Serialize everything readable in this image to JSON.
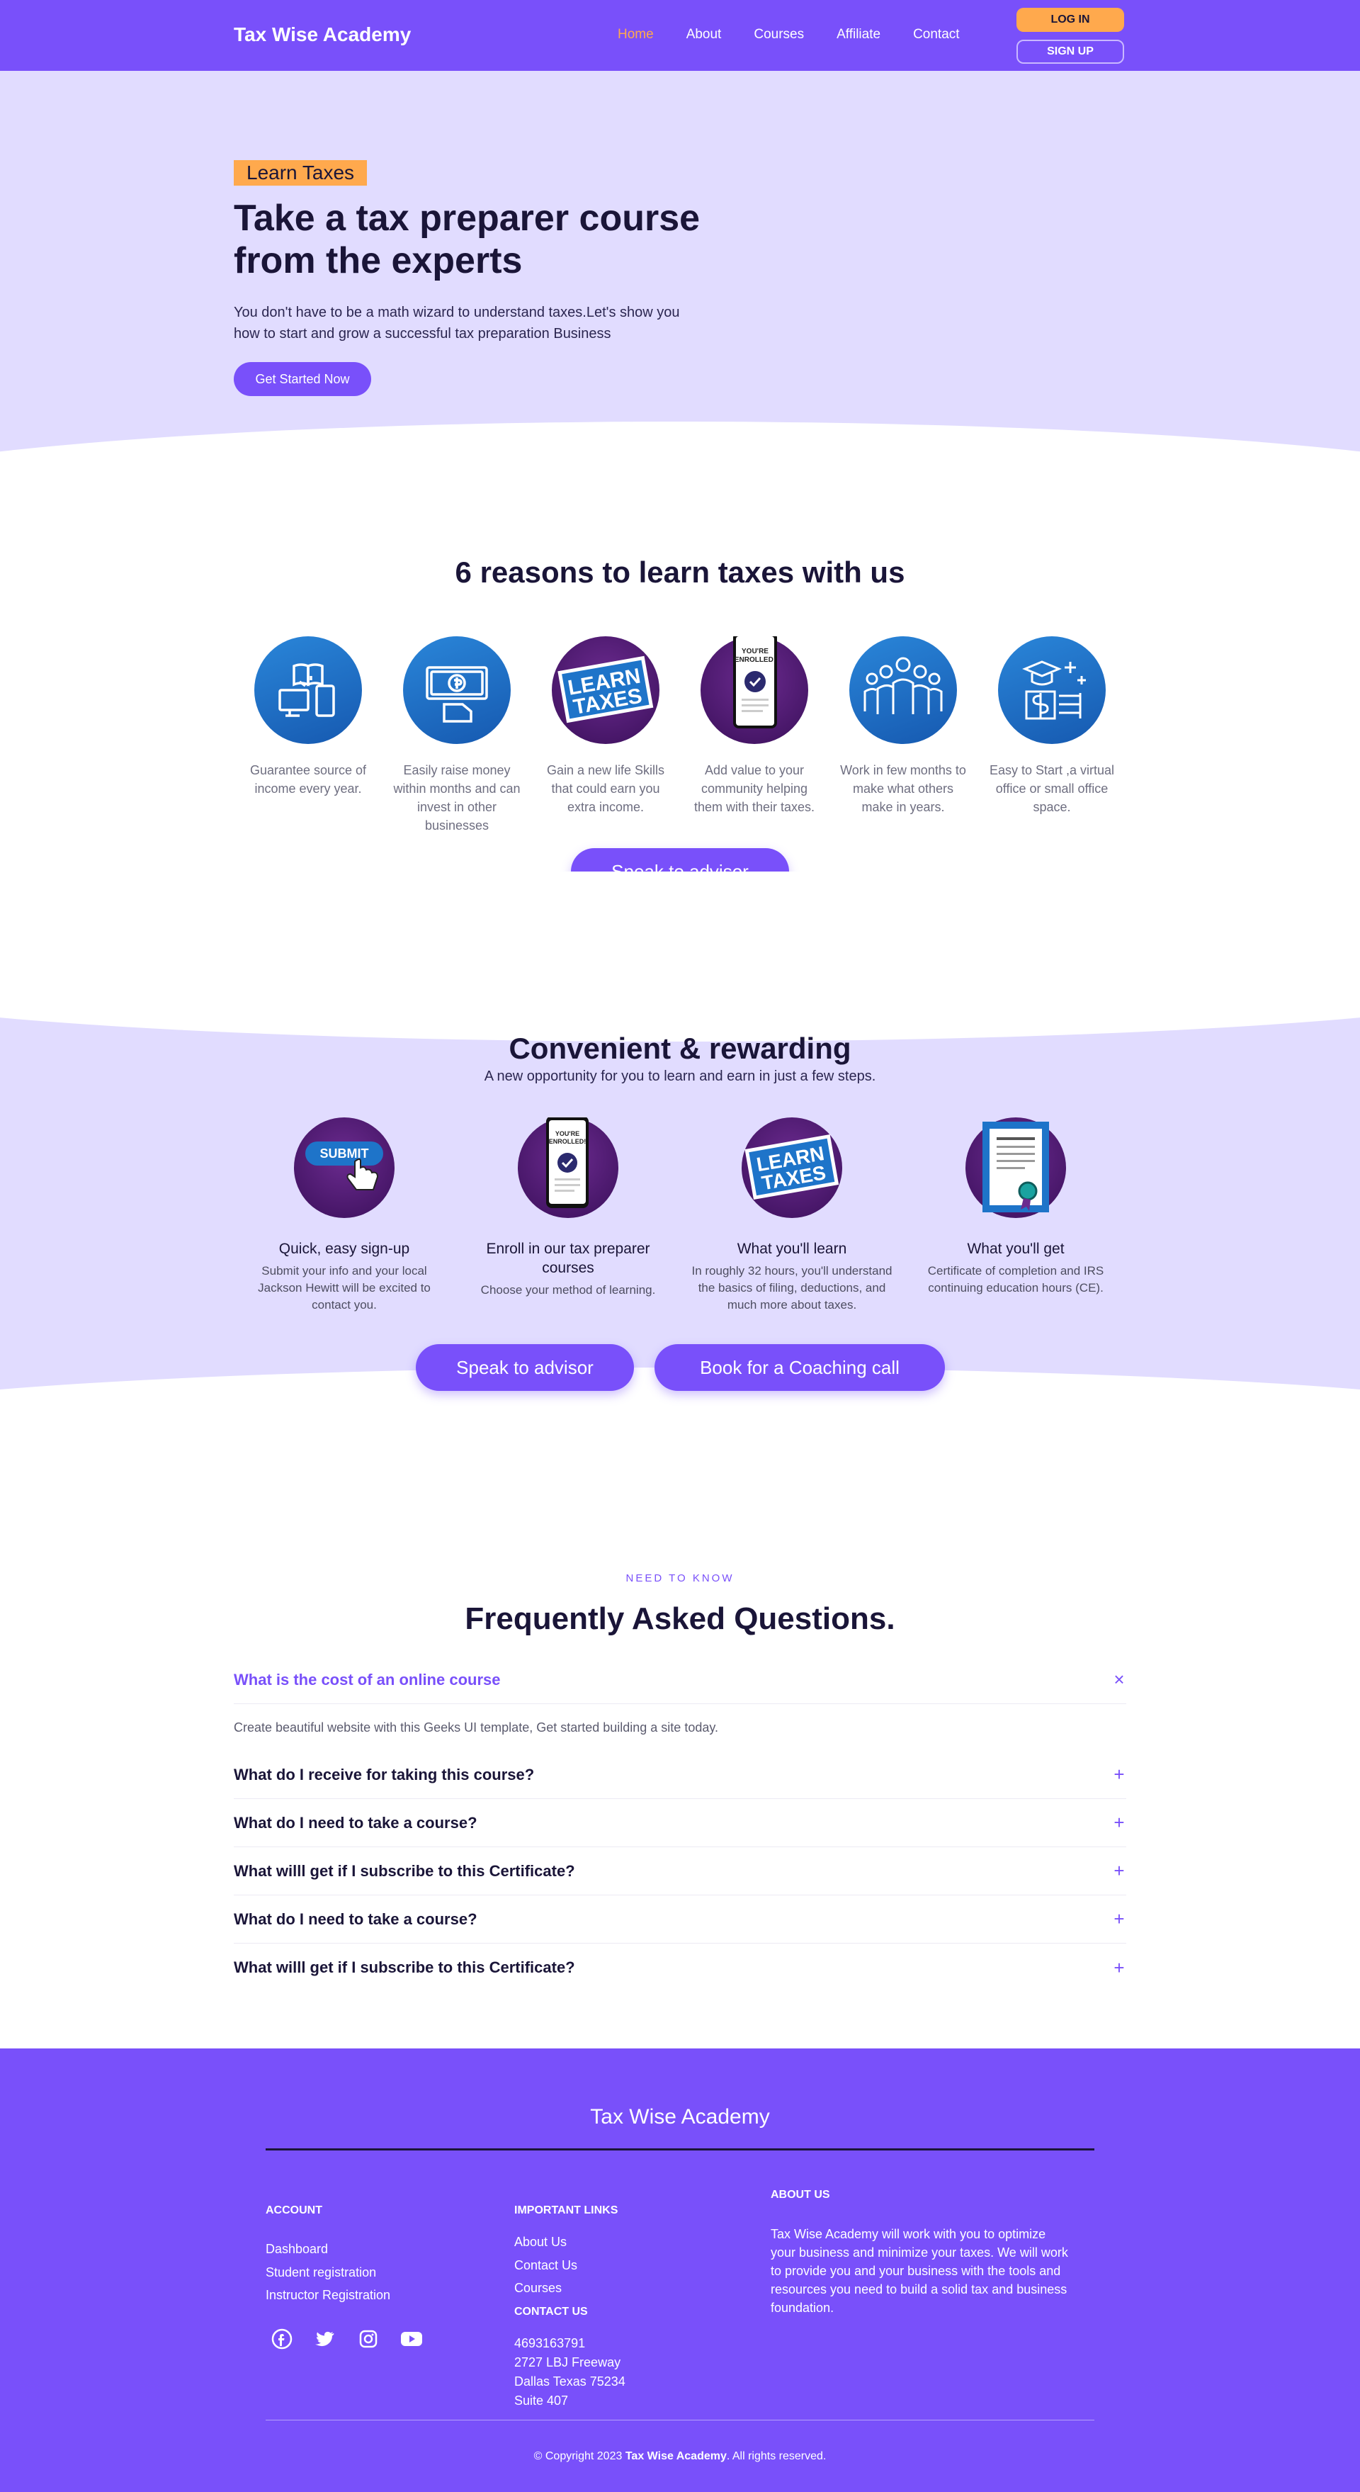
{
  "nav": {
    "brand": "Tax Wise Academy",
    "links": [
      "Home",
      "About",
      "Courses",
      "Affiliate",
      "Contact"
    ],
    "login": "LOG IN",
    "signup": "SIGN UP",
    "active_color": "#ffa94d"
  },
  "hero": {
    "tag": "Learn Taxes",
    "title": "Take a tax preparer course from the experts",
    "subtitle": "You don't have to be a math wizard to understand taxes.Let's show you how to start and grow a successful tax preparation Business",
    "cta": "Get Started Now"
  },
  "reasons": {
    "title": "6 reasons to learn taxes with us",
    "items": [
      {
        "text": "Guarantee source of income every year.",
        "icon": "computer-devices-icon"
      },
      {
        "text": "Easily raise money within months and can invest in other businesses",
        "icon": "money-hand-icon"
      },
      {
        "text": "Gain a new life Skills that could earn you extra income.",
        "icon": "learn-taxes-sign-icon",
        "sign": "LEARN TAXES"
      },
      {
        "text": "Add value to your community helping them with their taxes.",
        "icon": "enrolled-phone-icon",
        "phone_text": "YOU'RE ENROLLED!"
      },
      {
        "text": "Work in few months to make what others make in years.",
        "icon": "people-group-icon"
      },
      {
        "text": "Easy to Start ,a virtual office or small office space.",
        "icon": "graduation-finance-icon"
      }
    ],
    "cta": "Speak to advisor"
  },
  "convenient": {
    "title": "Convenient & rewarding",
    "subtitle": "A new opportunity for you to learn and earn in just a few steps.",
    "steps": [
      {
        "title": "Quick, easy sign-up",
        "text": "Submit your info and your local Jackson Hewitt will be excited to contact you.",
        "badge": "SUBMIT"
      },
      {
        "title": "Enroll in our tax preparer courses",
        "text": "Choose your method of learning.",
        "phone_text": "YOU'RE ENROLLED!"
      },
      {
        "title": "What you'll learn",
        "text": "In roughly 32 hours, you'll understand the basics of filing, deductions, and much more about taxes.",
        "sign": "LEARN TAXES"
      },
      {
        "title": "What you'll get",
        "text": "Certificate of completion and IRS continuing education hours (CE)."
      }
    ],
    "cta_advisor": "Speak to advisor",
    "cta_coaching": "Book for a Coaching call"
  },
  "faq": {
    "kicker": "NEED TO KNOW",
    "title": "Frequently Asked Questions.",
    "items": [
      {
        "q": "What is the cost of an online course",
        "a": "Create beautiful website with this Geeks UI template, Get started building a site today.",
        "open": true
      },
      {
        "q": "What do I receive for taking this course?",
        "open": false
      },
      {
        "q": "What do I need to take a course?",
        "open": false
      },
      {
        "q": "What willl get if I subscribe to this Certificate?",
        "open": false
      },
      {
        "q": "What do I need to take a course?",
        "open": false
      },
      {
        "q": "What willl get if I subscribe to this Certificate?",
        "open": false
      }
    ],
    "open_symbol": "×",
    "closed_symbol": "+"
  },
  "footer": {
    "brand": "Tax Wise Academy",
    "account": {
      "heading": "ACCOUNT",
      "links": [
        "Dashboard",
        "Student registration",
        "Instructor Registration"
      ]
    },
    "important": {
      "heading": "IMPORTANT LINKS",
      "links": [
        "About Us",
        "Contact Us",
        "Courses"
      ]
    },
    "contact": {
      "heading": "CONTACT US",
      "lines": [
        "4693163791",
        "2727 LBJ Freeway",
        "Dallas Texas 75234",
        "Suite 407"
      ]
    },
    "about": {
      "heading": "ABOUT US",
      "text": "Tax Wise Academy will work with you to optimize your business and minimize your taxes. We will work to provide you and your business with the tools and resources you need to build a solid tax and business foundation."
    },
    "social": [
      "facebook-icon",
      "twitter-icon",
      "instagram-icon",
      "youtube-icon"
    ],
    "copyright_pre": "© Copyright 2023",
    "copyright_brand": "Tax Wise Academy",
    "copyright_post": ". All rights reserved."
  },
  "colors": {
    "primary": "#7950fa",
    "accent": "#ffa94d",
    "lavender": "#e1dcff",
    "dark": "#1a1538",
    "icon_blue": "#1a6fc7",
    "icon_purple": "#4a1670"
  }
}
